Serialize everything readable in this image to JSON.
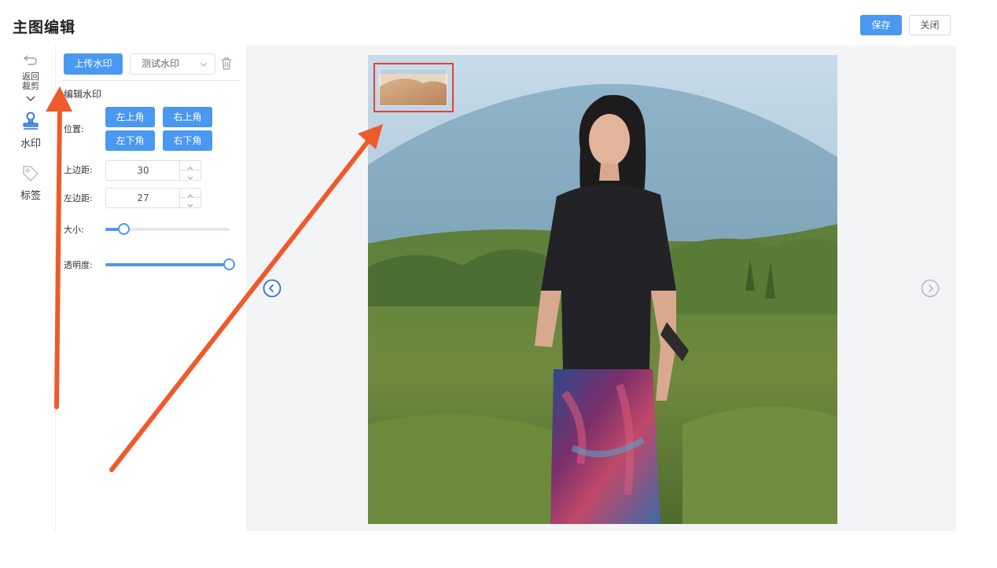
{
  "header": {
    "title": "主图编辑",
    "save_label": "保存",
    "close_label": "关闭"
  },
  "rail": {
    "back_label": "返回裁剪",
    "watermark_label": "水印",
    "tag_label": "标签"
  },
  "panel": {
    "upload_label": "上传水印",
    "watermark_select_value": "测试水印",
    "section_title": "编辑水印",
    "position_label": "位置:",
    "positions": [
      "左上角",
      "右上角",
      "左下角",
      "右下角"
    ],
    "top_margin_label": "上边距:",
    "top_margin_value": "30",
    "left_margin_label": "左边距:",
    "left_margin_value": "27",
    "size_label": "大小:",
    "size_fraction": 0.15,
    "opacity_label": "透明度:",
    "opacity_fraction": 1.0
  },
  "colors": {
    "accent": "#4a98f0",
    "annotation_arrow": "#ee5a2c",
    "highlight_box": "#e0413a"
  },
  "icons": {
    "back": "undo-arrow-icon",
    "watermark": "stamp-icon",
    "tag": "tag-icon",
    "delete": "trash-icon",
    "prev": "chevron-left-circle-icon",
    "next": "chevron-right-circle-icon"
  }
}
